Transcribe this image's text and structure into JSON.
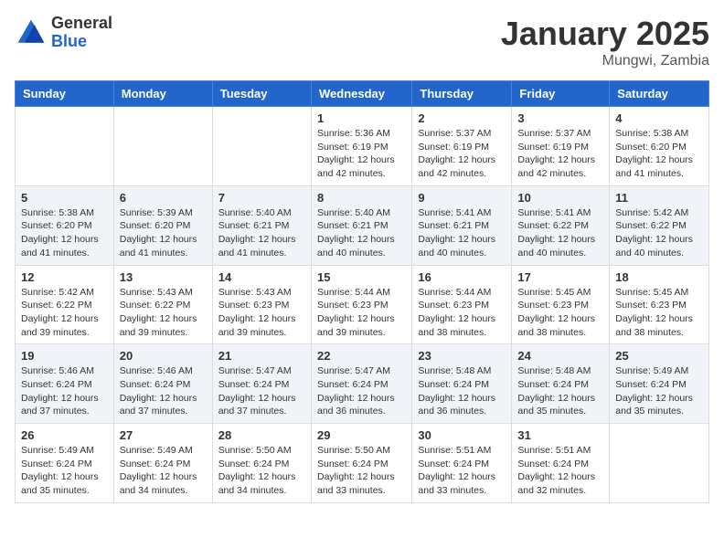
{
  "header": {
    "logo_general": "General",
    "logo_blue": "Blue",
    "title": "January 2025",
    "location": "Mungwi, Zambia"
  },
  "days_of_week": [
    "Sunday",
    "Monday",
    "Tuesday",
    "Wednesday",
    "Thursday",
    "Friday",
    "Saturday"
  ],
  "weeks": [
    [
      {
        "day": "",
        "info": ""
      },
      {
        "day": "",
        "info": ""
      },
      {
        "day": "",
        "info": ""
      },
      {
        "day": "1",
        "info": "Sunrise: 5:36 AM\nSunset: 6:19 PM\nDaylight: 12 hours and 42 minutes."
      },
      {
        "day": "2",
        "info": "Sunrise: 5:37 AM\nSunset: 6:19 PM\nDaylight: 12 hours and 42 minutes."
      },
      {
        "day": "3",
        "info": "Sunrise: 5:37 AM\nSunset: 6:19 PM\nDaylight: 12 hours and 42 minutes."
      },
      {
        "day": "4",
        "info": "Sunrise: 5:38 AM\nSunset: 6:20 PM\nDaylight: 12 hours and 41 minutes."
      }
    ],
    [
      {
        "day": "5",
        "info": "Sunrise: 5:38 AM\nSunset: 6:20 PM\nDaylight: 12 hours and 41 minutes."
      },
      {
        "day": "6",
        "info": "Sunrise: 5:39 AM\nSunset: 6:20 PM\nDaylight: 12 hours and 41 minutes."
      },
      {
        "day": "7",
        "info": "Sunrise: 5:40 AM\nSunset: 6:21 PM\nDaylight: 12 hours and 41 minutes."
      },
      {
        "day": "8",
        "info": "Sunrise: 5:40 AM\nSunset: 6:21 PM\nDaylight: 12 hours and 40 minutes."
      },
      {
        "day": "9",
        "info": "Sunrise: 5:41 AM\nSunset: 6:21 PM\nDaylight: 12 hours and 40 minutes."
      },
      {
        "day": "10",
        "info": "Sunrise: 5:41 AM\nSunset: 6:22 PM\nDaylight: 12 hours and 40 minutes."
      },
      {
        "day": "11",
        "info": "Sunrise: 5:42 AM\nSunset: 6:22 PM\nDaylight: 12 hours and 40 minutes."
      }
    ],
    [
      {
        "day": "12",
        "info": "Sunrise: 5:42 AM\nSunset: 6:22 PM\nDaylight: 12 hours and 39 minutes."
      },
      {
        "day": "13",
        "info": "Sunrise: 5:43 AM\nSunset: 6:22 PM\nDaylight: 12 hours and 39 minutes."
      },
      {
        "day": "14",
        "info": "Sunrise: 5:43 AM\nSunset: 6:23 PM\nDaylight: 12 hours and 39 minutes."
      },
      {
        "day": "15",
        "info": "Sunrise: 5:44 AM\nSunset: 6:23 PM\nDaylight: 12 hours and 39 minutes."
      },
      {
        "day": "16",
        "info": "Sunrise: 5:44 AM\nSunset: 6:23 PM\nDaylight: 12 hours and 38 minutes."
      },
      {
        "day": "17",
        "info": "Sunrise: 5:45 AM\nSunset: 6:23 PM\nDaylight: 12 hours and 38 minutes."
      },
      {
        "day": "18",
        "info": "Sunrise: 5:45 AM\nSunset: 6:23 PM\nDaylight: 12 hours and 38 minutes."
      }
    ],
    [
      {
        "day": "19",
        "info": "Sunrise: 5:46 AM\nSunset: 6:24 PM\nDaylight: 12 hours and 37 minutes."
      },
      {
        "day": "20",
        "info": "Sunrise: 5:46 AM\nSunset: 6:24 PM\nDaylight: 12 hours and 37 minutes."
      },
      {
        "day": "21",
        "info": "Sunrise: 5:47 AM\nSunset: 6:24 PM\nDaylight: 12 hours and 37 minutes."
      },
      {
        "day": "22",
        "info": "Sunrise: 5:47 AM\nSunset: 6:24 PM\nDaylight: 12 hours and 36 minutes."
      },
      {
        "day": "23",
        "info": "Sunrise: 5:48 AM\nSunset: 6:24 PM\nDaylight: 12 hours and 36 minutes."
      },
      {
        "day": "24",
        "info": "Sunrise: 5:48 AM\nSunset: 6:24 PM\nDaylight: 12 hours and 35 minutes."
      },
      {
        "day": "25",
        "info": "Sunrise: 5:49 AM\nSunset: 6:24 PM\nDaylight: 12 hours and 35 minutes."
      }
    ],
    [
      {
        "day": "26",
        "info": "Sunrise: 5:49 AM\nSunset: 6:24 PM\nDaylight: 12 hours and 35 minutes."
      },
      {
        "day": "27",
        "info": "Sunrise: 5:49 AM\nSunset: 6:24 PM\nDaylight: 12 hours and 34 minutes."
      },
      {
        "day": "28",
        "info": "Sunrise: 5:50 AM\nSunset: 6:24 PM\nDaylight: 12 hours and 34 minutes."
      },
      {
        "day": "29",
        "info": "Sunrise: 5:50 AM\nSunset: 6:24 PM\nDaylight: 12 hours and 33 minutes."
      },
      {
        "day": "30",
        "info": "Sunrise: 5:51 AM\nSunset: 6:24 PM\nDaylight: 12 hours and 33 minutes."
      },
      {
        "day": "31",
        "info": "Sunrise: 5:51 AM\nSunset: 6:24 PM\nDaylight: 12 hours and 32 minutes."
      },
      {
        "day": "",
        "info": ""
      }
    ]
  ]
}
